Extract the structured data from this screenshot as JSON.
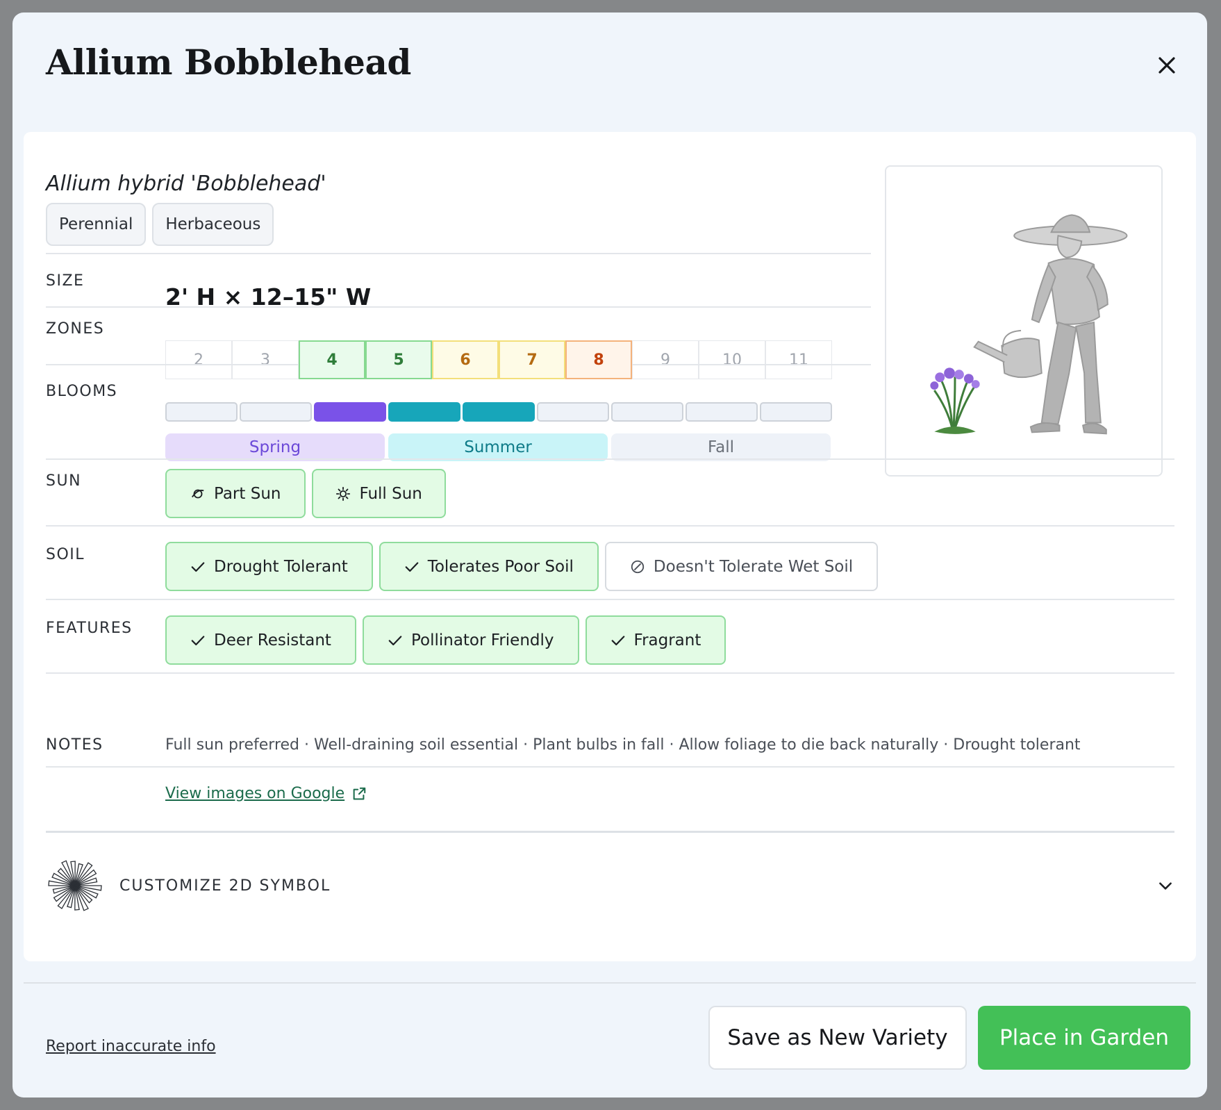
{
  "plant": {
    "common_name": "Allium Bobblehead",
    "scientific_name": "Allium hybrid 'Bobblehead'",
    "types": [
      "Perennial",
      "Herbaceous"
    ]
  },
  "labels": {
    "size": "SIZE",
    "zones": "ZONES",
    "blooms": "BLOOMS",
    "sun": "SUN",
    "soil": "SOIL",
    "features": "FEATURES",
    "notes": "NOTES"
  },
  "size": {
    "value": "2' H × 12–15\" W"
  },
  "zones": [
    {
      "label": "2",
      "active": false
    },
    {
      "label": "3",
      "active": false
    },
    {
      "label": "4",
      "active": true,
      "border": "#86d990",
      "bg": "#e9fbec",
      "color": "#2f7d3a"
    },
    {
      "label": "5",
      "active": true,
      "border": "#86d990",
      "bg": "#e9fbec",
      "color": "#2f7d3a"
    },
    {
      "label": "6",
      "active": true,
      "border": "#f3df7a",
      "bg": "#fefbe6",
      "color": "#b46a12"
    },
    {
      "label": "7",
      "active": true,
      "border": "#f3df7a",
      "bg": "#fefbe6",
      "color": "#b46a12"
    },
    {
      "label": "8",
      "active": true,
      "border": "#f4b27b",
      "bg": "#fff4ea",
      "color": "#c2410c"
    },
    {
      "label": "9",
      "active": false
    },
    {
      "label": "10",
      "active": false
    },
    {
      "label": "11",
      "active": false
    }
  ],
  "blooms": {
    "segments": [
      "empty",
      "empty",
      "spring",
      "summer",
      "summer",
      "empty",
      "empty",
      "empty",
      "empty"
    ],
    "seasons": [
      {
        "label": "Spring",
        "bg": "#e6dcfb",
        "color": "#6b48d8"
      },
      {
        "label": "Summer",
        "bg": "#c9f4f8",
        "color": "#0e7b88"
      },
      {
        "label": "Fall",
        "bg": "#eef2f8",
        "color": "#6a7079"
      }
    ],
    "colors": {
      "spring": "#7a52e8",
      "summer": "#17a6ba",
      "empty": "#eef2f8"
    }
  },
  "sun": [
    {
      "label": "Part Sun",
      "icon": "part-sun-icon"
    },
    {
      "label": "Full Sun",
      "icon": "full-sun-icon"
    }
  ],
  "soil": [
    {
      "label": "Drought Tolerant",
      "icon": "check-icon",
      "positive": true
    },
    {
      "label": "Tolerates Poor Soil",
      "icon": "check-icon",
      "positive": true
    },
    {
      "label": "Doesn't Tolerate Wet Soil",
      "icon": "prohibited-icon",
      "positive": false
    }
  ],
  "features": [
    {
      "label": "Deer Resistant",
      "icon": "check-icon"
    },
    {
      "label": "Pollinator Friendly",
      "icon": "check-icon"
    },
    {
      "label": "Fragrant",
      "icon": "check-icon"
    }
  ],
  "notes": "Full sun preferred · Well-draining soil essential · Plant bulbs in fall · Allow foliage to die back naturally · Drought tolerant",
  "links": {
    "google": "View images on Google",
    "report": "Report inaccurate info"
  },
  "symbol": {
    "label": "CUSTOMIZE 2D SYMBOL"
  },
  "actions": {
    "save_variety": "Save as New Variety",
    "place_in_garden": "Place in Garden"
  }
}
